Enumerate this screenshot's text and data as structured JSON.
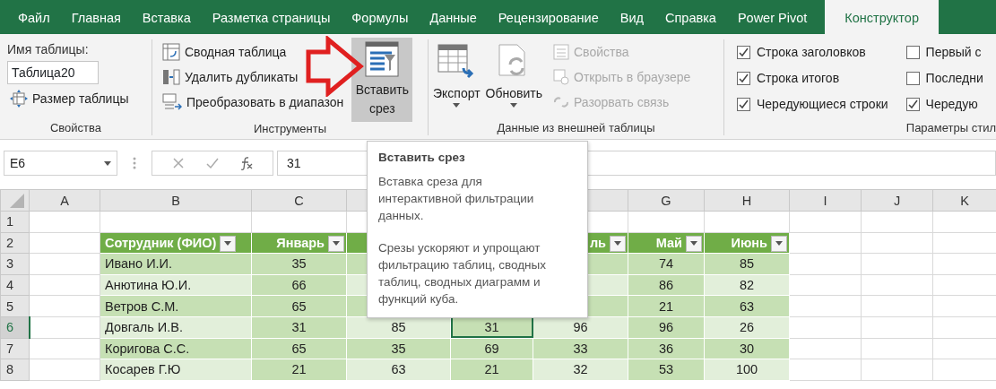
{
  "tabs": [
    {
      "label": "Файл",
      "selected": false
    },
    {
      "label": "Главная",
      "selected": false
    },
    {
      "label": "Вставка",
      "selected": false
    },
    {
      "label": "Разметка страницы",
      "selected": false
    },
    {
      "label": "Формулы",
      "selected": false
    },
    {
      "label": "Данные",
      "selected": false
    },
    {
      "label": "Рецензирование",
      "selected": false
    },
    {
      "label": "Вид",
      "selected": false
    },
    {
      "label": "Справка",
      "selected": false
    },
    {
      "label": "Power Pivot",
      "selected": false
    },
    {
      "label": "Конструктор",
      "selected": true
    }
  ],
  "ribbon": {
    "properties": {
      "caption": "Имя таблицы:",
      "table_name": "Таблица20",
      "resize_button": "Размер таблицы",
      "label": "Свойства"
    },
    "tools": {
      "buttons": [
        {
          "label": "Сводная таблица",
          "kind": "pivot"
        },
        {
          "label": "Удалить дубликаты",
          "kind": "dedupe"
        },
        {
          "label": "Преобразовать в диапазон",
          "kind": "convert"
        }
      ],
      "slicer_button": {
        "label": "Вставить срез",
        "hovered": true
      },
      "label": "Инструменты"
    },
    "external": {
      "big_buttons": [
        {
          "label": "Экспорт",
          "kind": "export"
        },
        {
          "label": "Обновить",
          "kind": "refresh"
        }
      ],
      "small_buttons": [
        {
          "label": "Свойства",
          "kind": "props",
          "disabled": true
        },
        {
          "label": "Открыть в браузере",
          "kind": "browser",
          "disabled": true
        },
        {
          "label": "Разорвать связь",
          "kind": "unlink",
          "disabled": true
        }
      ],
      "label": "Данные из внешней таблицы"
    },
    "style_options": {
      "columns": [
        [
          {
            "label": "Строка заголовков",
            "checked": true
          },
          {
            "label": "Строка итогов",
            "checked": true
          },
          {
            "label": "Чередующиеся строки",
            "checked": true
          }
        ],
        [
          {
            "label": "Первый с",
            "checked": false
          },
          {
            "label": "Последни",
            "checked": false
          },
          {
            "label": "Чередую",
            "checked": true
          }
        ]
      ],
      "label": "Параметры стил"
    }
  },
  "formula_bar": {
    "name_box": "E6",
    "value": "31"
  },
  "tooltip": {
    "title": "Вставить срез",
    "paragraphs": [
      "Вставка среза для интерактивной фильтрации данных.",
      "Срезы ускоряют и упрощают фильтрацию таблиц, сводных таблиц, сводных диаграмм и функций куба."
    ]
  },
  "sheet": {
    "columns": [
      {
        "label": "A",
        "selected": false
      },
      {
        "label": "B",
        "selected": false
      },
      {
        "label": "C",
        "selected": false
      },
      {
        "selected": false
      },
      {
        "selected": true
      },
      {
        "selected": false
      },
      {
        "label": "G",
        "selected": false
      },
      {
        "label": "H",
        "selected": false
      },
      {
        "label": "I",
        "selected": false
      },
      {
        "label": "J",
        "selected": false
      },
      {
        "label": "K",
        "selected": false
      }
    ],
    "rows": [
      {
        "number": "1",
        "selected": false,
        "kind": "empty"
      },
      {
        "number": "2",
        "selected": false,
        "kind": "header",
        "cells": [
          "Сотрудник (ФИО)",
          "Январь",
          null,
          null,
          "ль",
          "Май",
          "Июнь"
        ]
      },
      {
        "number": "3",
        "selected": false,
        "kind": "data",
        "cells": [
          "Ивано И.И.",
          "35",
          null,
          null,
          null,
          "74",
          "85"
        ]
      },
      {
        "number": "4",
        "selected": false,
        "kind": "data",
        "cells": [
          "Анютина Ю.И.",
          "66",
          null,
          null,
          null,
          "86",
          "82"
        ]
      },
      {
        "number": "5",
        "selected": false,
        "kind": "data",
        "cells": [
          "Ветров С.М.",
          "65",
          null,
          null,
          null,
          "21",
          "63"
        ]
      },
      {
        "number": "6",
        "selected": true,
        "kind": "data",
        "cells": [
          "Довгаль И.В.",
          "31",
          "85",
          "31",
          "96",
          "96",
          "26"
        ]
      },
      {
        "number": "7",
        "selected": false,
        "kind": "data",
        "cells": [
          "Коригова С.С.",
          "65",
          "35",
          "69",
          "33",
          "36",
          "30"
        ]
      },
      {
        "number": "8",
        "selected": false,
        "kind": "data",
        "cells": [
          "Косарев Г.Ю",
          "21",
          "63",
          "21",
          "32",
          "53",
          "100"
        ]
      }
    ]
  }
}
